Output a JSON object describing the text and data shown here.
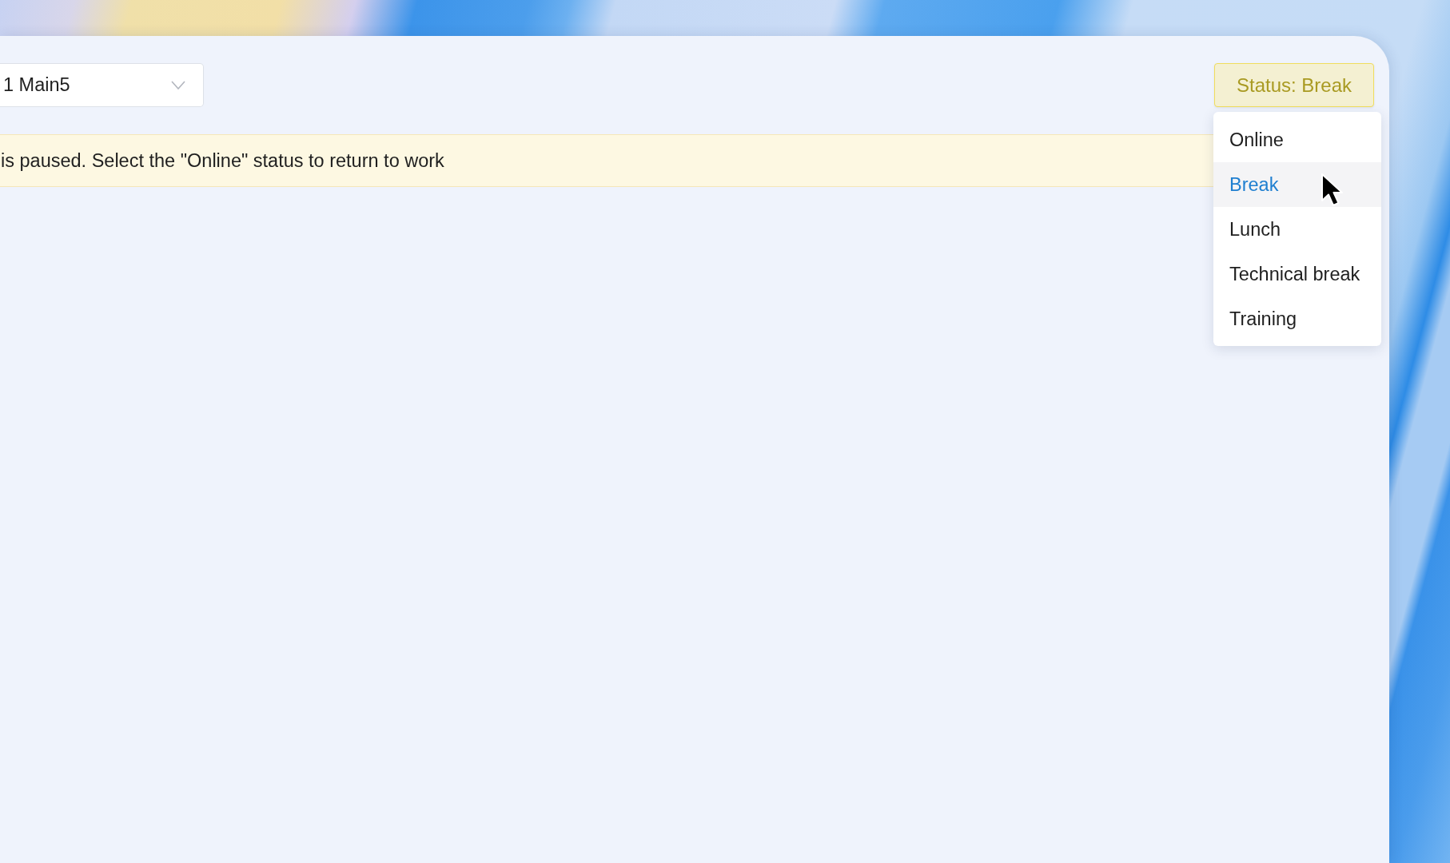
{
  "station_select": {
    "value": "1 Main5"
  },
  "notice": {
    "text": "is paused. Select the \"Online\" status to return to work"
  },
  "status_button": {
    "label": "Status: Break",
    "expanded": true
  },
  "status_menu": {
    "items": [
      {
        "label": "Online",
        "selected": false
      },
      {
        "label": "Break",
        "selected": true
      },
      {
        "label": "Lunch",
        "selected": false
      },
      {
        "label": "Technical break",
        "selected": false
      },
      {
        "label": "Training",
        "selected": false
      }
    ]
  }
}
